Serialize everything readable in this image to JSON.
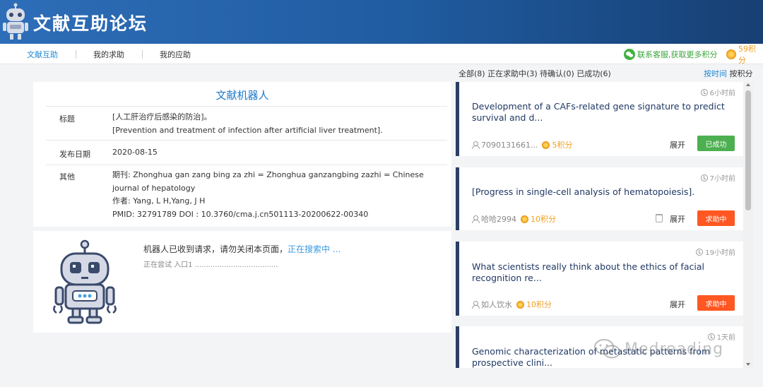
{
  "header": {
    "title": "文献互助论坛"
  },
  "nav": {
    "items": [
      {
        "label": "文献互助",
        "active": true
      },
      {
        "label": "我的求助",
        "active": false
      },
      {
        "label": "我的应助",
        "active": false
      }
    ],
    "contact_label": "联系客服,获取更多积分",
    "points_label": "59积分"
  },
  "filter": {
    "summary": "全部(8) 正在求助中(3) 待确认(0) 已成功(6)",
    "sort_time": "按时间",
    "sort_points": "按积分"
  },
  "document": {
    "heading": "文献机器人",
    "rows": [
      {
        "label": "标题",
        "lines": [
          "[人工肝治疗后感染的防治]。",
          "[Prevention and treatment of infection after artificial liver treatment]."
        ]
      },
      {
        "label": "发布日期",
        "lines": [
          "2020-08-15"
        ]
      },
      {
        "label": "其他",
        "lines": [
          "期刊: Zhonghua gan zang bing za zhi = Zhonghua ganzangbing zazhi = Chinese",
          "journal of hepatology",
          "作者: Yang, L H,Yang, J H",
          "PMID: 32791789 DOI : 10.3760/cma.j.cn501113-20200622-00340"
        ]
      }
    ]
  },
  "robot": {
    "message": "机器人已收到请求，请勿关闭本页面，",
    "searching": "正在搜索中 ...",
    "sub": "正在尝试 入口1 ....................................."
  },
  "requests": [
    {
      "time": "6小时前",
      "title_lines": [
        "Development of a CAFs-related gene signature to predict",
        "survival and d..."
      ],
      "user": "7090131661...",
      "points": "5积分",
      "expand": "展开",
      "status": "已成功",
      "status_type": "success",
      "trash": false
    },
    {
      "time": "7小时前",
      "title_lines": [
        "[Progress in single-cell analysis of hematopoiesis]."
      ],
      "user": "哈哈2994",
      "points": "10积分",
      "expand": "展开",
      "status": "求助中",
      "status_type": "pending",
      "trash": true
    },
    {
      "time": "19小时前",
      "title_lines": [
        "What scientists really think about the ethics of facial",
        "recognition re..."
      ],
      "user": "如人饮水",
      "points": "10积分",
      "expand": "展开",
      "status": "求助中",
      "status_type": "pending",
      "trash": false
    },
    {
      "time": "1天前",
      "title_lines": [
        "Genomic characterization of metastatic patterns from",
        "prospective clini..."
      ],
      "user": "",
      "points": "",
      "expand": "",
      "status": "",
      "status_type": "",
      "trash": false
    }
  ],
  "watermark": "Medreading",
  "colors": {
    "header": "#1f5b9f",
    "accent": "#1e88d4",
    "success": "#4caf50",
    "pending": "#ff5722",
    "card_border": "#2b3f63"
  }
}
